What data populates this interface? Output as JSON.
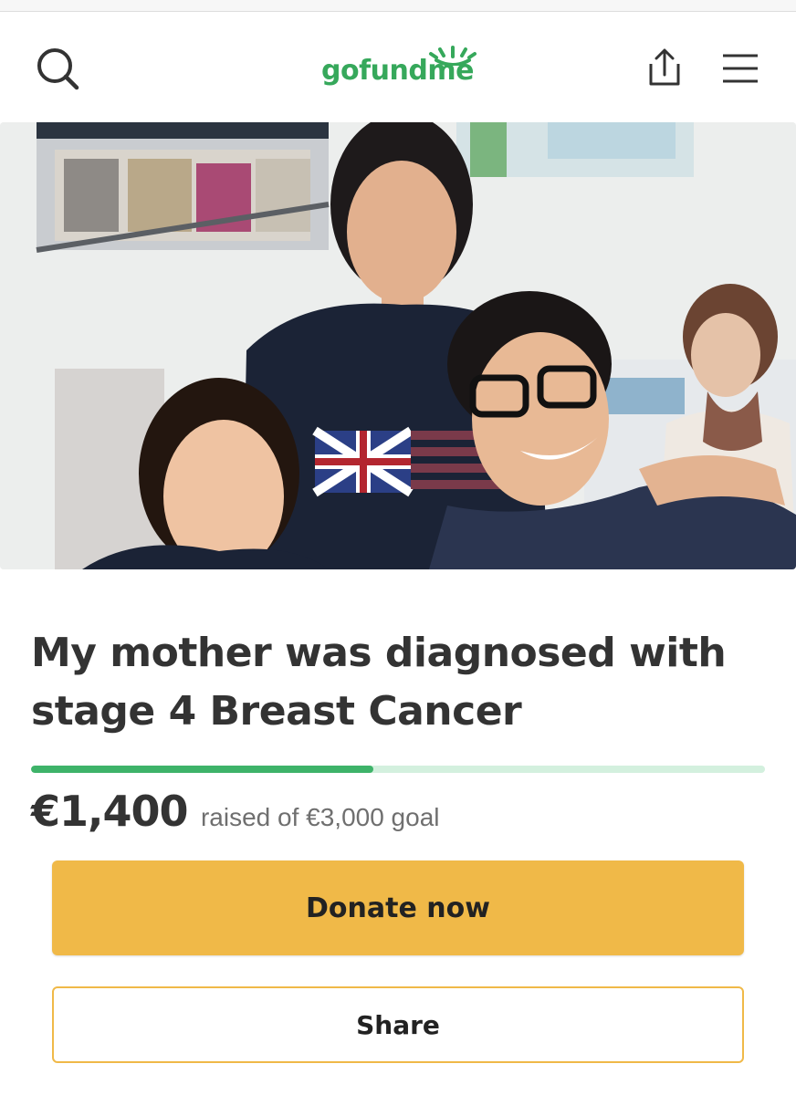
{
  "header": {
    "logo_text": "gofundme",
    "icons": {
      "search": "search-icon",
      "share": "share-upload-icon",
      "menu": "hamburger-menu-icon"
    }
  },
  "hero": {
    "image_name": "campaign-photo"
  },
  "campaign": {
    "title": "My mother was diagnosed with stage 4 Breast Cancer",
    "amount_raised": "€1,400",
    "goal_text": "raised of €3,000 goal",
    "progress_fraction": 0.4667
  },
  "actions": {
    "donate_label": "Donate now",
    "share_label": "Share"
  },
  "colors": {
    "brand_green": "#36a85b",
    "progress_fill": "#3eb369",
    "progress_track": "#d3f0de",
    "donate_button": "#f0b948"
  }
}
